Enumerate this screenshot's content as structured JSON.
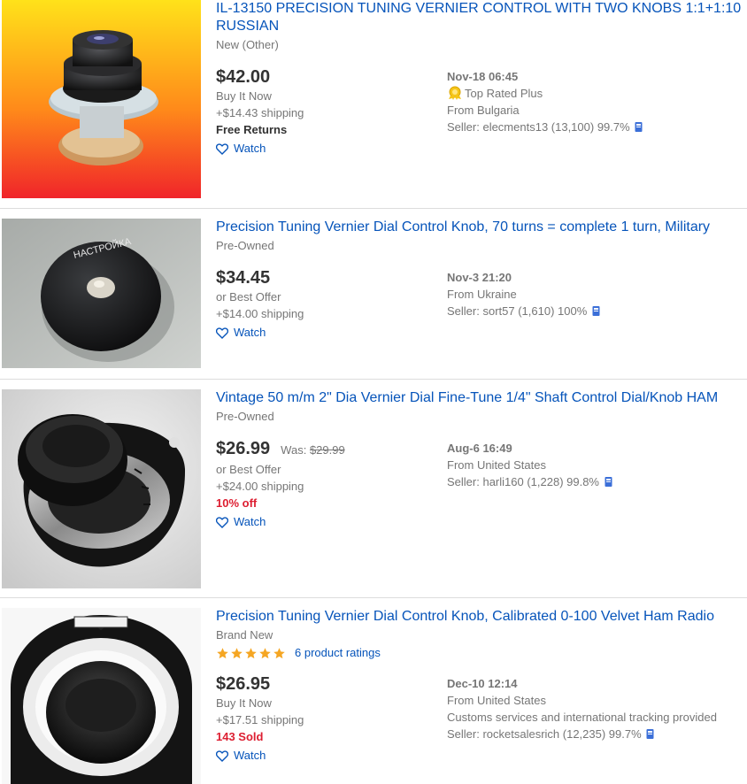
{
  "listings": [
    {
      "title": "IL-13150 PRECISION TUNING VERNIER CONTROL WITH TWO KNOBS 1:1+1:10 RUSSIAN",
      "condition": "New (Other)",
      "price": "$42.00",
      "buy_format": "Buy It Now",
      "shipping": "+$14.43 shipping",
      "returns": "Free Returns",
      "watch": "Watch",
      "date": "Nov-18 06:45",
      "top_rated": "Top Rated Plus",
      "location": "From Bulgaria",
      "seller": "Seller: elecments13 (13,100) 99.7%"
    },
    {
      "title": "Precision Tuning Vernier Dial Control Knob, 70 turns = complete 1 turn, Military",
      "condition": "Pre-Owned",
      "price": "$34.45",
      "buy_format": "or Best Offer",
      "shipping": "+$14.00 shipping",
      "watch": "Watch",
      "date": "Nov-3 21:20",
      "location": "From Ukraine",
      "seller": "Seller: sort57 (1,610) 100%",
      "image_text": "НАСТРОЙКА"
    },
    {
      "title": "Vintage 50 m/m 2\" Dia Vernier Dial Fine-Tune 1/4\" Shaft Control Dial/Knob HAM",
      "condition": "Pre-Owned",
      "price": "$26.99",
      "was_label": "Was:",
      "was_price": "$29.99",
      "buy_format": "or Best Offer",
      "shipping": "+$24.00 shipping",
      "discount": "10% off",
      "watch": "Watch",
      "date": "Aug-6 16:49",
      "location": "From United States",
      "seller": "Seller: harli160 (1,228) 99.8%"
    },
    {
      "title": "Precision Tuning Vernier Dial Control Knob, Calibrated 0-100 Velvet Ham Radio",
      "condition": "Brand New",
      "ratings": "6 product ratings",
      "stars": 5,
      "price": "$26.95",
      "buy_format": "Buy It Now",
      "shipping": "+$17.51 shipping",
      "sold": "143 Sold",
      "watch": "Watch",
      "date": "Dec-10 12:14",
      "location": "From United States",
      "extra": "Customs services and international tracking provided",
      "seller": "Seller: rocketsalesrich (12,235) 99.7%"
    }
  ],
  "colors": {
    "link": "#0654ba",
    "discount": "#dd1e31",
    "star": "#f5a623"
  }
}
